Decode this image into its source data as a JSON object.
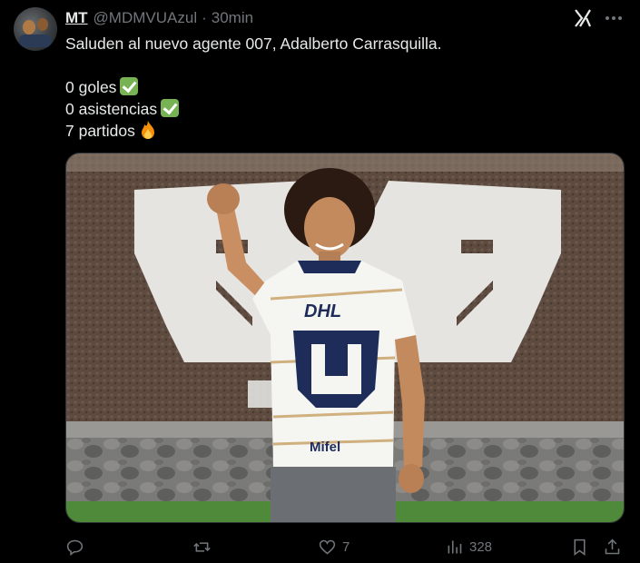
{
  "post": {
    "author_name": "MT",
    "handle": "@MDMVUAzul",
    "separator": "·",
    "time": "30min",
    "text_line1": "Saluden al nuevo agente 007, Adalberto Carrasquilla.",
    "text_line2": "0 goles",
    "text_line3": "0 asistencias",
    "text_line4": "7 partidos"
  },
  "actions": {
    "reply_count": "",
    "repost_count": "",
    "like_count": "7",
    "views_count": "328"
  },
  "icons": {
    "header": [
      "grok-icon",
      "more-icon"
    ],
    "actions": [
      "reply-icon",
      "repost-icon",
      "like-icon",
      "views-icon",
      "bookmark-icon",
      "share-icon"
    ],
    "emoji": [
      "check-mark-emoji",
      "fire-emoji"
    ]
  },
  "colors": {
    "background": "#000000",
    "text": "#e7e9ea",
    "muted": "#71767b",
    "check_green": "#77b255"
  }
}
